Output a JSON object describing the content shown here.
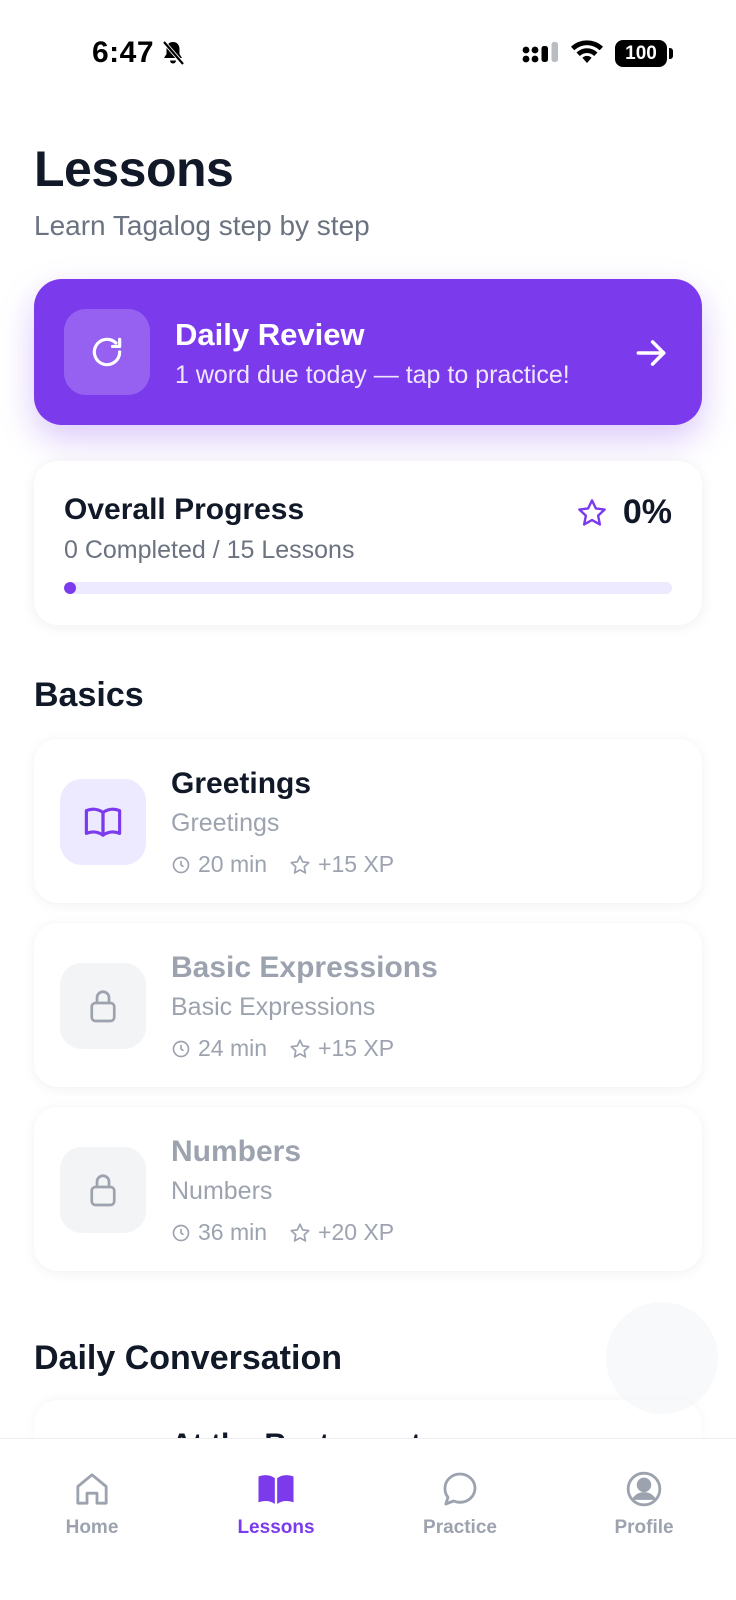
{
  "status_bar": {
    "time": "6:47",
    "battery": "100"
  },
  "header": {
    "title": "Lessons",
    "subtitle": "Learn Tagalog step by step"
  },
  "daily_review": {
    "title": "Daily Review",
    "subtitle": "1 word due today — tap to practice!"
  },
  "overall_progress": {
    "title": "Overall Progress",
    "summary": "0 Completed / 15 Lessons",
    "percent_label": "0%",
    "completed_fraction": 0.0
  },
  "sections": [
    {
      "title": "Basics",
      "lessons": [
        {
          "title": "Greetings",
          "subtitle": "Greetings",
          "duration": "20 min",
          "xp": "+15 XP",
          "locked": false
        },
        {
          "title": "Basic Expressions",
          "subtitle": "Basic Expressions",
          "duration": "24 min",
          "xp": "+15 XP",
          "locked": true
        },
        {
          "title": "Numbers",
          "subtitle": "Numbers",
          "duration": "36 min",
          "xp": "+20 XP",
          "locked": true
        }
      ]
    },
    {
      "title": "Daily Conversation",
      "lessons": [
        {
          "title": "At the Restaurant"
        }
      ]
    }
  ],
  "tab_bar": {
    "tabs": [
      {
        "label": "Home",
        "icon": "home-icon"
      },
      {
        "label": "Lessons",
        "icon": "book-icon"
      },
      {
        "label": "Practice",
        "icon": "chat-bubble-icon"
      },
      {
        "label": "Profile",
        "icon": "user-circle-icon"
      }
    ],
    "active_index": 1
  },
  "colors": {
    "accent": "#7c3aed",
    "accent_light": "#ede9fe",
    "text_primary": "#111827",
    "text_secondary": "#6b7280",
    "text_muted": "#9ca3af"
  }
}
